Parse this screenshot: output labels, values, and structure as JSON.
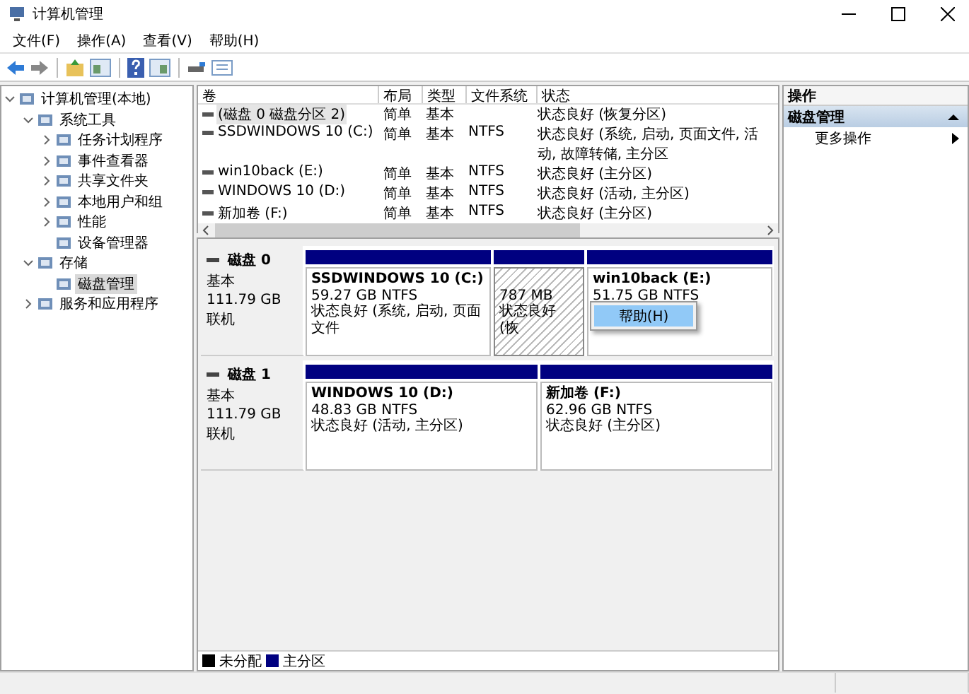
{
  "window": {
    "title": "计算机管理"
  },
  "menu": [
    "文件(F)",
    "操作(A)",
    "查看(V)",
    "帮助(H)"
  ],
  "tree": [
    {
      "label": "计算机管理(本地)",
      "selected": false,
      "expanded": true,
      "children": [
        {
          "label": "系统工具",
          "selected": false,
          "expanded": true,
          "children": [
            {
              "label": "任务计划程序",
              "selected": false,
              "expanded": false
            },
            {
              "label": "事件查看器",
              "selected": false,
              "expanded": false
            },
            {
              "label": "共享文件夹",
              "selected": false,
              "expanded": false
            },
            {
              "label": "本地用户和组",
              "selected": false,
              "expanded": false
            },
            {
              "label": "性能",
              "selected": false,
              "expanded": false
            },
            {
              "label": "设备管理器",
              "selected": false
            }
          ]
        },
        {
          "label": "存储",
          "selected": false,
          "expanded": true,
          "children": [
            {
              "label": "磁盘管理",
              "selected": true
            }
          ]
        },
        {
          "label": "服务和应用程序",
          "selected": false,
          "expanded": false
        }
      ]
    }
  ],
  "table": {
    "columns": [
      "卷",
      "布局",
      "类型",
      "文件系统",
      "状态"
    ],
    "rows": [
      {
        "cells": [
          "(磁盘 0 磁盘分区 2)",
          "简单",
          "基本",
          "",
          "状态良好 (恢复分区)"
        ],
        "selected": true
      },
      {
        "cells": [
          "SSDWINDOWS 10 (C:)",
          "简单",
          "基本",
          "NTFS",
          "状态良好 (系统, 启动, 页面文件, 活动, 故障转储, 主分区"
        ],
        "selected": false
      },
      {
        "cells": [
          "win10back (E:)",
          "简单",
          "基本",
          "NTFS",
          "状态良好 (主分区)"
        ],
        "selected": false
      },
      {
        "cells": [
          "WINDOWS 10 (D:)",
          "简单",
          "基本",
          "NTFS",
          "状态良好 (活动, 主分区)"
        ],
        "selected": false
      },
      {
        "cells": [
          "新加卷 (F:)",
          "简单",
          "基本",
          "NTFS",
          "状态良好 (主分区)"
        ],
        "selected": false
      }
    ]
  },
  "disks": [
    {
      "name": "磁盘 0",
      "type": "基本",
      "size": "111.79 GB",
      "status": "联机",
      "partitions": [
        {
          "label": "SSDWINDOWS 10  (C:)",
          "size": "59.27 GB NTFS",
          "status": "状态良好 (系统, 启动, 页面文件",
          "selected": false
        },
        {
          "size": "787 MB",
          "status": "状态良好 (恢",
          "selected": true
        },
        {
          "label": "win10back  (E:)",
          "size": "51.75 GB NTFS",
          "selected": false
        }
      ]
    },
    {
      "name": "磁盘 1",
      "type": "基本",
      "size": "111.79 GB",
      "status": "联机",
      "partitions": [
        {
          "label": "WINDOWS 10  (D:)",
          "size": "48.83 GB NTFS",
          "status": "状态良好 (活动, 主分区)",
          "selected": false
        },
        {
          "label": "新加卷  (F:)",
          "size": "62.96 GB NTFS",
          "status": "状态良好 (主分区)",
          "selected": false
        }
      ]
    }
  ],
  "context_menu": {
    "items": [
      "帮助(H)"
    ]
  },
  "legend": [
    {
      "label": "未分配",
      "color": "#000000"
    },
    {
      "label": "主分区",
      "color": "#000080"
    }
  ],
  "actions": {
    "title": "操作",
    "section": "磁盘管理",
    "items": [
      "更多操作"
    ]
  }
}
